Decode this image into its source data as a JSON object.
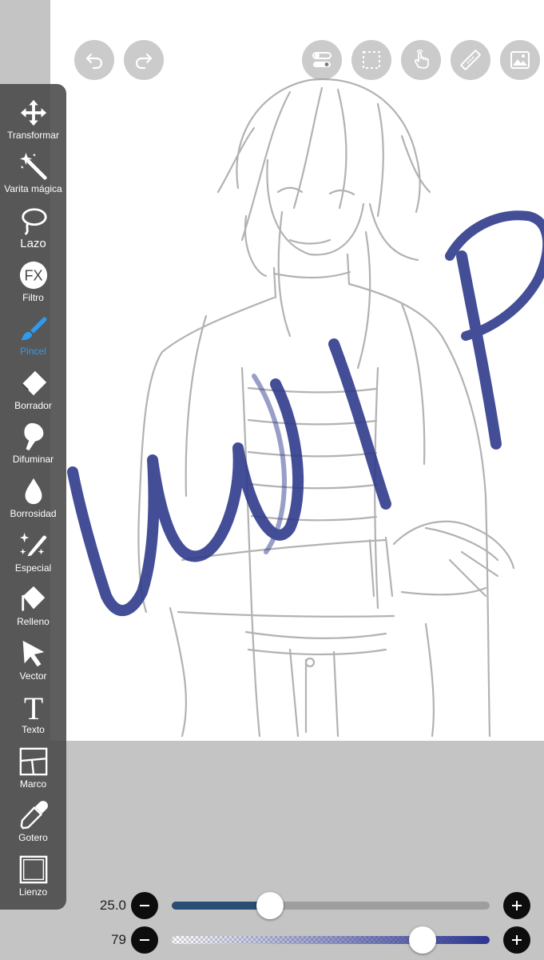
{
  "tools": [
    {
      "id": "transform",
      "label": "Transformar",
      "icon": "move-arrows-icon"
    },
    {
      "id": "magic-wand",
      "label": "Varita mágica",
      "icon": "magic-wand-icon"
    },
    {
      "id": "lasso",
      "label": "Lazo",
      "icon": "lasso-icon"
    },
    {
      "id": "filter",
      "label": "Filtro",
      "icon": "fx-icon"
    },
    {
      "id": "brush",
      "label": "Pincel",
      "icon": "brush-icon",
      "active": true
    },
    {
      "id": "eraser",
      "label": "Borrador",
      "icon": "eraser-icon"
    },
    {
      "id": "smudge",
      "label": "Difuminar",
      "icon": "smudge-finger-icon"
    },
    {
      "id": "blur",
      "label": "Borrosidad",
      "icon": "droplet-icon"
    },
    {
      "id": "special",
      "label": "Especial",
      "icon": "sparkle-pen-icon"
    },
    {
      "id": "fill",
      "label": "Relleno",
      "icon": "paint-bucket-icon"
    },
    {
      "id": "vector",
      "label": "Vector",
      "icon": "pointer-arrow-icon"
    },
    {
      "id": "text",
      "label": "Texto",
      "icon": "text-t-icon"
    },
    {
      "id": "frame",
      "label": "Marco",
      "icon": "frame-panels-icon"
    },
    {
      "id": "eyedropper",
      "label": "Gotero",
      "icon": "eyedropper-icon"
    },
    {
      "id": "canvas",
      "label": "Lienzo",
      "icon": "canvas-square-icon"
    }
  ],
  "brush_size": {
    "label": "25.0",
    "value": 25.0,
    "fraction": 0.31
  },
  "opacity": {
    "label": "79",
    "value": 79,
    "fraction": 0.79
  },
  "colors": {
    "active_tool": "#2e9bf0",
    "stroke": "#2e3a8c",
    "size_track": "#2a4d73",
    "opacity_track": "#2c3592"
  }
}
